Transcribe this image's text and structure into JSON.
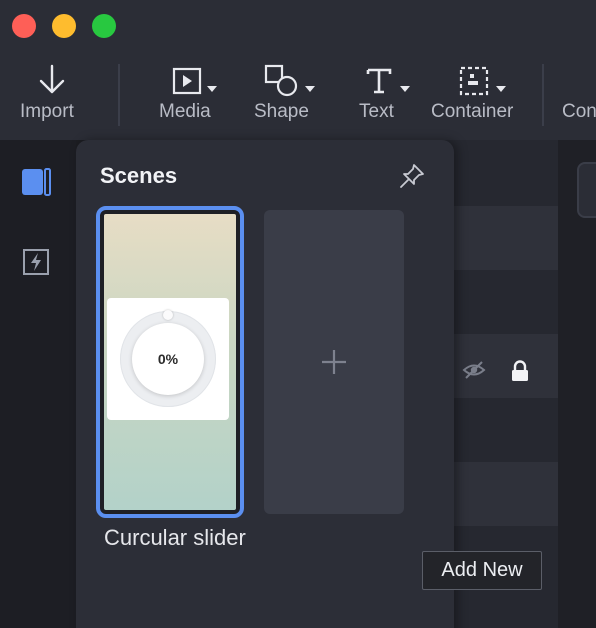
{
  "toolbar": {
    "import_label": "Import",
    "media_label": "Media",
    "shape_label": "Shape",
    "text_label": "Text",
    "container_label": "Container",
    "cut_label": "Con"
  },
  "scenes_panel": {
    "title": "Scenes",
    "scenes": [
      {
        "name": "Curcular slider",
        "preview_value": "0%"
      }
    ],
    "add_new_tooltip": "Add New"
  },
  "colors": {
    "accent": "#5b8ff0",
    "toolbar_bg": "#2b2d36",
    "panel_bg": "#2c2e37"
  }
}
